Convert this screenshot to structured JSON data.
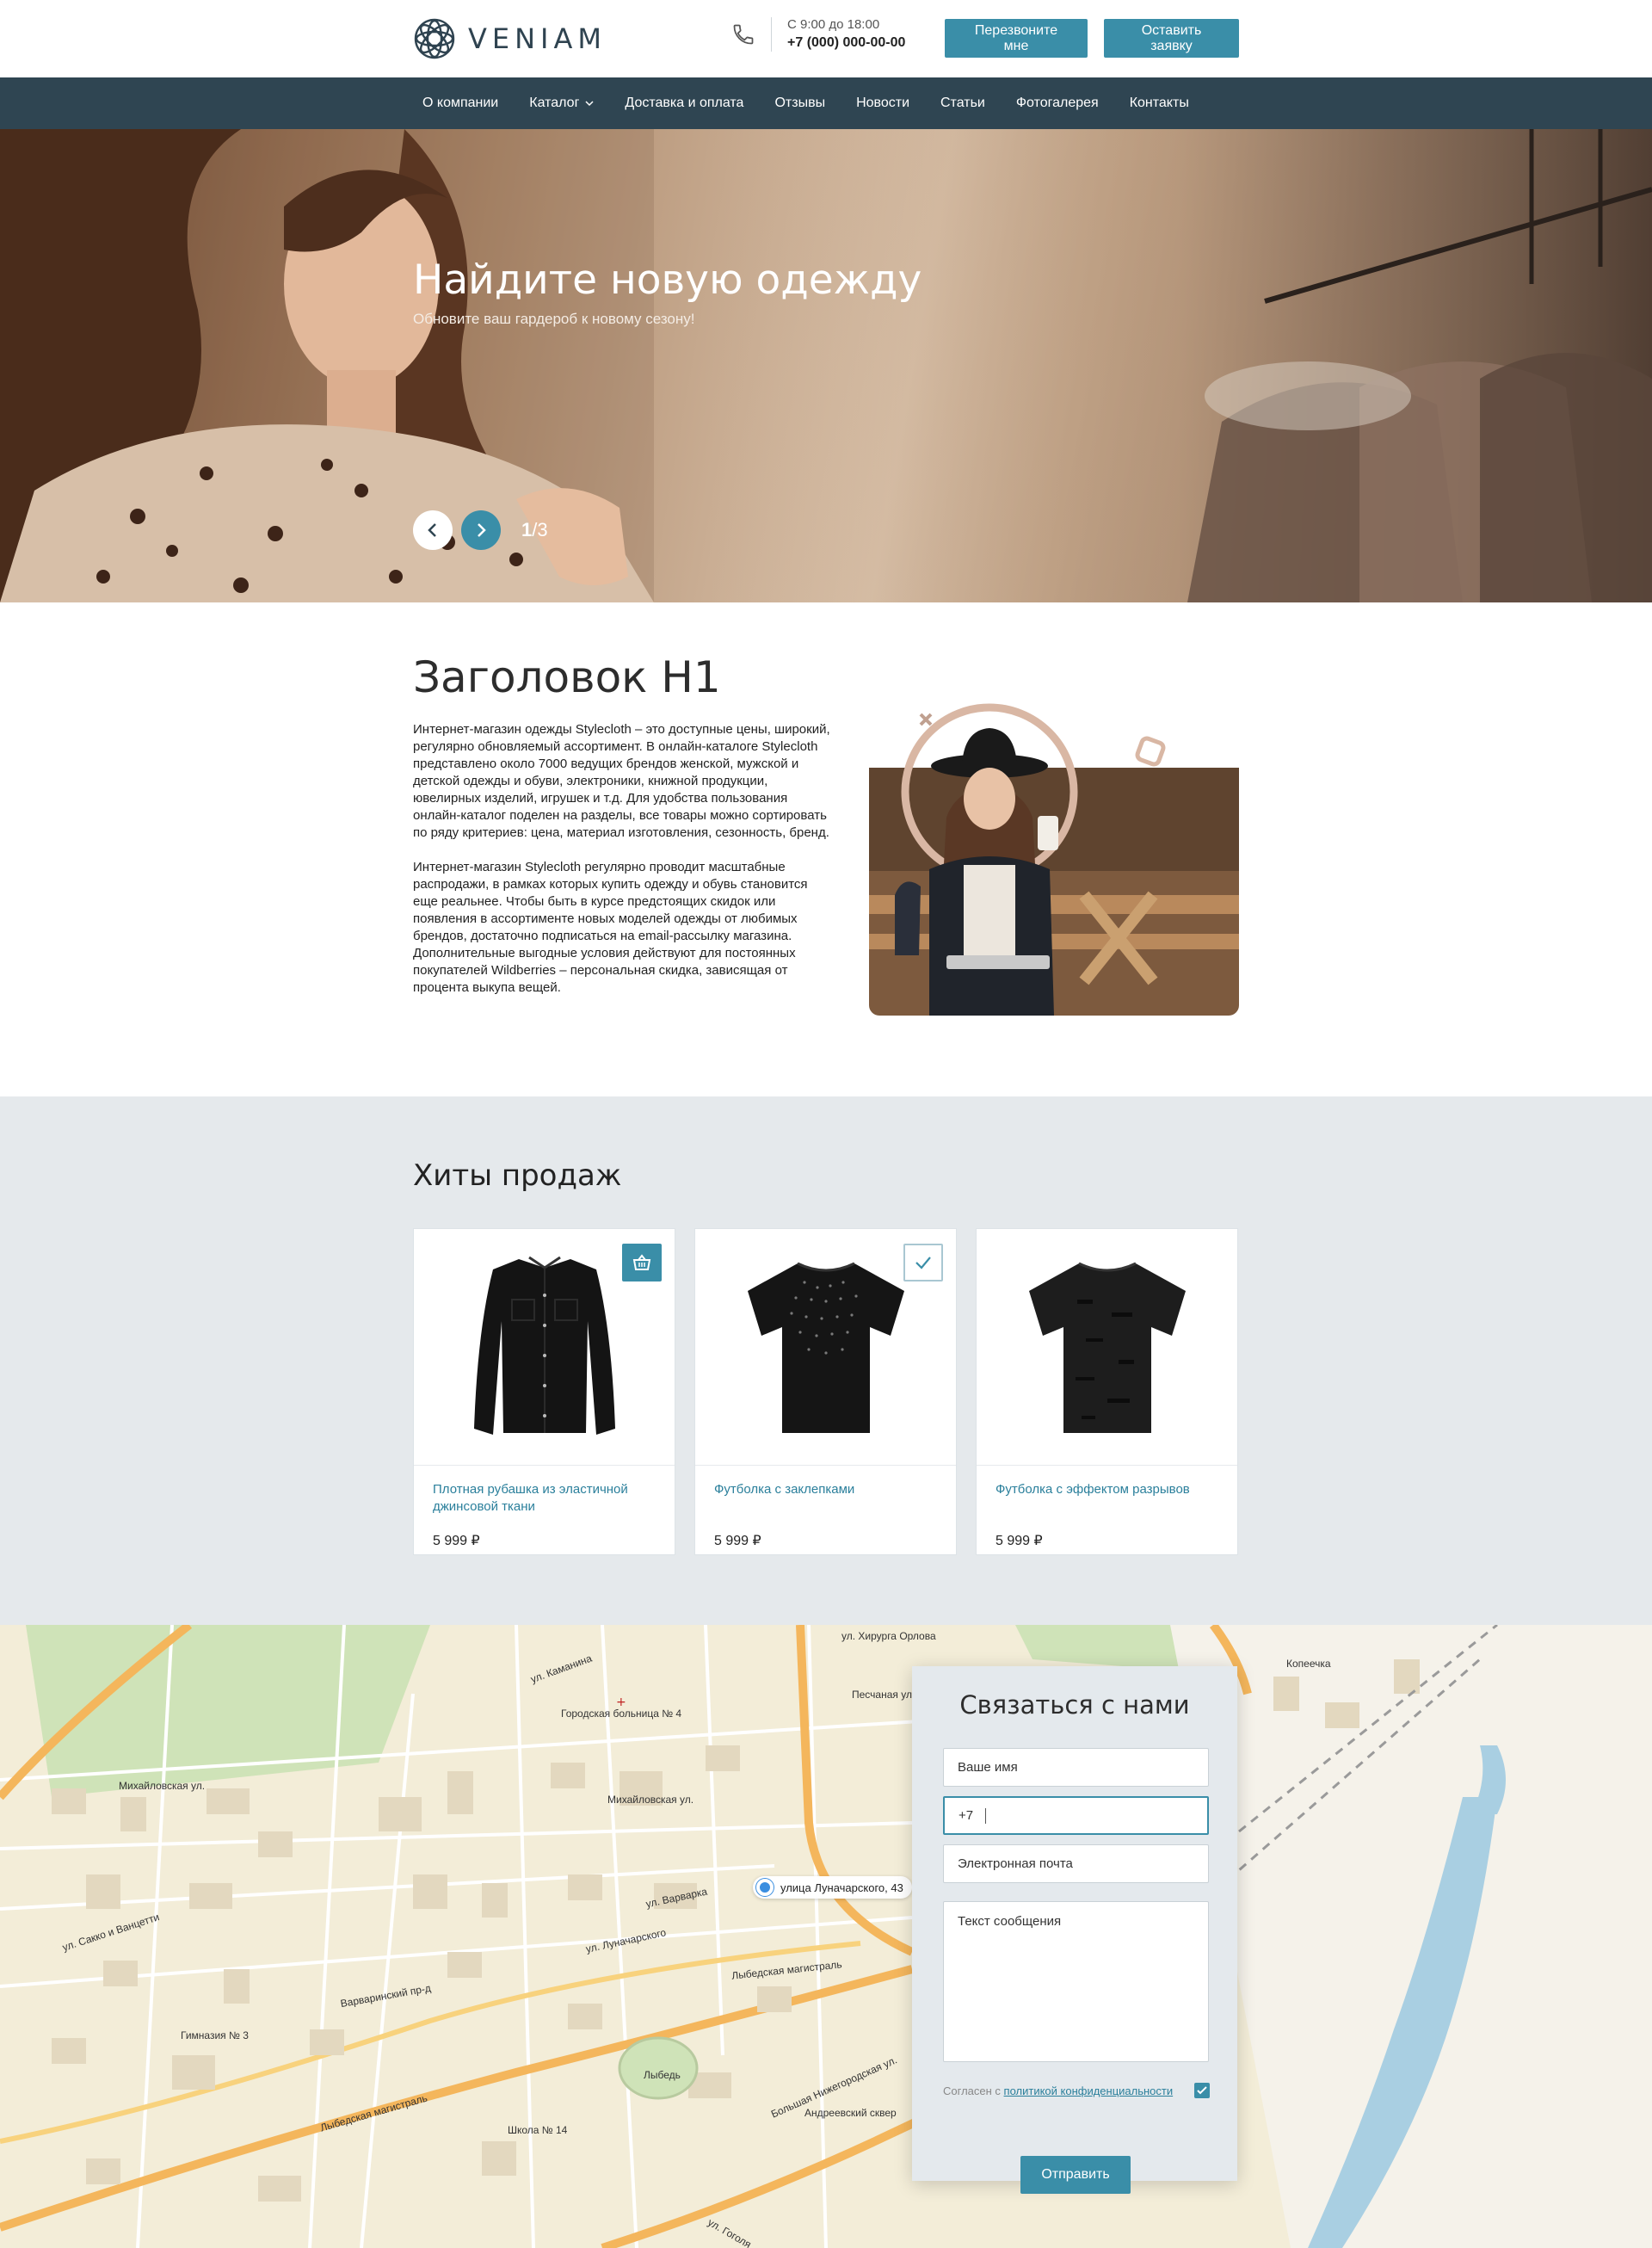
{
  "header": {
    "brand": "VENIAM",
    "hours": "С 9:00 до 18:00",
    "phone": "+7 (000) 000-00-00",
    "callback_label": "Перезвоните мне",
    "request_label": "Оставить заявку"
  },
  "nav": {
    "items": [
      {
        "label": "О компании"
      },
      {
        "label": "Каталог",
        "dropdown": true
      },
      {
        "label": "Доставка и оплата"
      },
      {
        "label": "Отзывы"
      },
      {
        "label": "Новости"
      },
      {
        "label": "Статьи"
      },
      {
        "label": "Фотогалерея"
      },
      {
        "label": "Контакты"
      }
    ]
  },
  "hero": {
    "title": "Найдите новую одежду",
    "subtitle": "Обновите ваш гардероб к новому сезону!",
    "slide_current": "1",
    "slide_total": "/3"
  },
  "about": {
    "heading": "Заголовок H1",
    "paragraph1": "Интернет-магазин одежды Stylecloth – это доступные цены, широкий, регулярно обновляемый ассортимент. В онлайн-каталоге Stylecloth представлено около 7000 ведущих брендов женской, мужской и детской одежды и обуви, электроники, книжной продукции, ювелирных изделий, игрушек и т.д. Для удобства пользования онлайн-каталог поделен на разделы, все товары можно сортировать по ряду критериев: цена, материал изготовления, сезонность, бренд.",
    "paragraph2": "Интернет-магазин Stylecloth регулярно проводит масштабные распродажи, в рамках которых купить одежду и обувь становится еще реальнее. Чтобы быть в курсе предстоящих скидок или появления в ассортименте новых моделей одежды от любимых брендов, достаточно подписаться на email-рассылку магазина. Дополнительные выгодные условия действуют для постоянных покупателей Wildberries – персональная скидка, зависящая от процента выкупа вещей."
  },
  "hits": {
    "heading": "Хиты продаж",
    "products": [
      {
        "title": "Плотная рубашка из эластичной джинсовой ткани",
        "price": "5 999 ₽",
        "badge": "cart-icon"
      },
      {
        "title": "Футболка с заклепками",
        "price": "5 999 ₽",
        "badge": "check-icon"
      },
      {
        "title": "Футболка с эффектом разрывов",
        "price": "5 999 ₽",
        "badge": ""
      }
    ]
  },
  "map": {
    "address": "улица Луначарского, 43",
    "labels": [
      {
        "text": "ул. Хирурга Орлова"
      },
      {
        "text": "ул. Каманина"
      },
      {
        "text": "Городская больница № 4"
      },
      {
        "text": "Песчаная ул."
      },
      {
        "text": "Михайловская ул."
      },
      {
        "text": "Михайловская ул."
      },
      {
        "text": "ул. Сакко и Ванцетти"
      },
      {
        "text": "ул. Варварка"
      },
      {
        "text": "ул. Луначарского"
      },
      {
        "text": "Лыбедская магистраль"
      },
      {
        "text": "Варваринский пр-д"
      },
      {
        "text": "Гимназия № 3"
      },
      {
        "text": "Лыбедь"
      },
      {
        "text": "Лыбедская магистраль"
      },
      {
        "text": "Большая Нижегородская ул."
      },
      {
        "text": "Андреевский сквер"
      },
      {
        "text": "Школа № 14"
      },
      {
        "text": "Копеечка"
      },
      {
        "text": "ул. Гоголя"
      }
    ]
  },
  "form": {
    "title": "Связаться с нами",
    "name_placeholder": "Ваше имя",
    "phone_value": "+7",
    "email_placeholder": "Электронная почта",
    "message_placeholder": "Текст сообщения",
    "agree_text": "Согласен с ",
    "agree_link": "политикой конфиденциальности",
    "agree_checked": true,
    "submit_label": "Отправить"
  },
  "colors": {
    "accent": "#3a8ea8",
    "nav_bg": "#2f4552",
    "hits_bg": "#e5e9ec",
    "link": "#2a7f9b"
  }
}
